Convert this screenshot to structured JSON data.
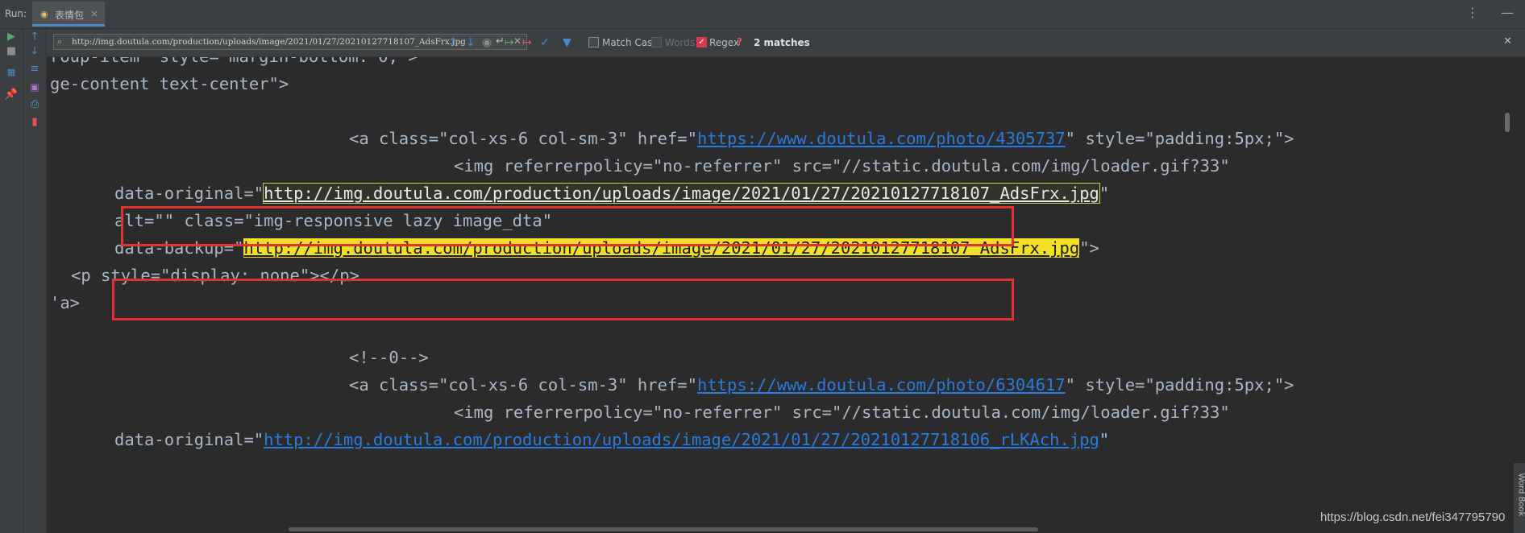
{
  "topbar": {
    "run_label": "Run:",
    "tab_label": "表情包",
    "tab_close": "×",
    "icons": [
      "more-vertical-icon",
      "minimize-icon"
    ]
  },
  "find": {
    "query": "http://img.doutula.com/production/uploads/image/2021/01/27/20210127718107_AdsFrx.jpg",
    "match_case_label": "Match Case",
    "words_label": "Words",
    "regex_label": "Regex",
    "regex_help": "?",
    "matches": "2 matches",
    "options": {
      "match_case": false,
      "words": false,
      "regex": true
    }
  },
  "code": {
    "l1": "roup-item\" style=\"margin-bottom: 0;\">",
    "l2": "ge-content text-center\">",
    "l4_pre": "<a class=\"col-xs-6 col-sm-3\" href=\"",
    "l4_url": "https://www.doutula.com/photo/4305737",
    "l4_post": "\" style=\"padding:5px;\">",
    "l5": "<img referrerpolicy=\"no-referrer\" src=\"//static.doutula.com/img/loader.gif?33\"",
    "l6_pre": "data-original=\"",
    "l6_url": "http://img.doutula.com/production/uploads/image/2021/01/27/20210127718107_AdsFrx.jpg",
    "l6_post": "\"",
    "l7": "alt=\"\" class=\"img-responsive lazy image_dta\"",
    "l8_pre": "data-backup=\"",
    "l8_url": "http://img.doutula.com/production/uploads/image/2021/01/27/20210127718107_AdsFrx.jpg",
    "l8_post": "\">",
    "l9": "<p style=\"display: none\"></p>",
    "l10": "'a>",
    "l12": "<!--0-->",
    "l13_pre": "<a class=\"col-xs-6 col-sm-3\" href=\"",
    "l13_url": "https://www.doutula.com/photo/6304617",
    "l13_post": "\" style=\"padding:5px;\">",
    "l14": "<img referrerpolicy=\"no-referrer\" src=\"//static.doutula.com/img/loader.gif?33\"",
    "l15_pre": "data-original=\"",
    "l15_url": "http://img.doutula.com/production/uploads/image/2021/01/27/20210127718106_rLKAch.jpg",
    "l15_post": "\""
  },
  "watermark": "https://blog.csdn.net/fei347795790",
  "wordbook": "Word Book",
  "colors": {
    "background": "#2b2b2b",
    "panel": "#3c3f41",
    "match_highlight": "#f0e02a",
    "annotation_box": "#e0332f",
    "link": "#287bde"
  }
}
